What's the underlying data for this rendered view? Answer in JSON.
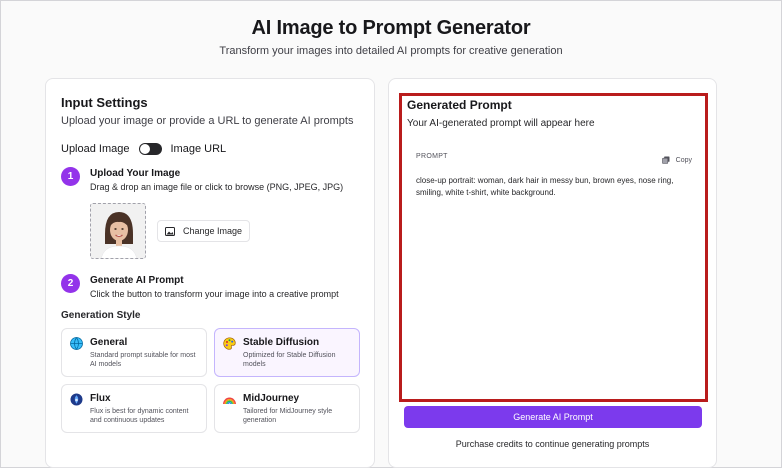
{
  "header": {
    "title": "AI Image to Prompt Generator",
    "subtitle": "Transform your images into detailed AI prompts for creative generation"
  },
  "input_settings": {
    "title": "Input Settings",
    "description": "Upload your image or provide a URL to generate AI prompts",
    "toggle": {
      "left_label": "Upload Image",
      "right_label": "Image URL"
    },
    "steps": [
      {
        "number": "1",
        "title": "Upload Your Image",
        "description": "Drag & drop an image file or click to browse (PNG, JPEG, JPG)"
      },
      {
        "number": "2",
        "title": "Generate AI Prompt",
        "description": "Click the button to transform your image into a creative prompt"
      }
    ],
    "change_image_label": "Change Image",
    "generation_style_label": "Generation Style",
    "styles": [
      {
        "name": "General",
        "description": "Standard prompt suitable for most AI models",
        "icon": "globe-icon",
        "selected": false
      },
      {
        "name": "Stable Diffusion",
        "description": "Optimized for Stable Diffusion models",
        "icon": "palette-icon",
        "selected": true
      },
      {
        "name": "Flux",
        "description": "Flux is best for dynamic content and continuous updates",
        "icon": "flux-icon",
        "selected": false
      },
      {
        "name": "MidJourney",
        "description": "Tailored for MidJourney style generation",
        "icon": "rainbow-icon",
        "selected": false
      }
    ]
  },
  "output": {
    "title": "Generated Prompt",
    "description": "Your AI-generated prompt will appear here",
    "prompt_label": "PROMPT",
    "copy_label": "Copy",
    "prompt_text": "close-up portrait: woman, dark hair in messy bun, brown eyes, nose ring, smiling, white t-shirt, white background.",
    "generate_button_label": "Generate AI Prompt",
    "purchase_note": "Purchase credits to continue generating prompts"
  },
  "colors": {
    "accent": "#7c3aed",
    "step_badge": "#9333ea",
    "highlight_border": "#b91c1c"
  }
}
